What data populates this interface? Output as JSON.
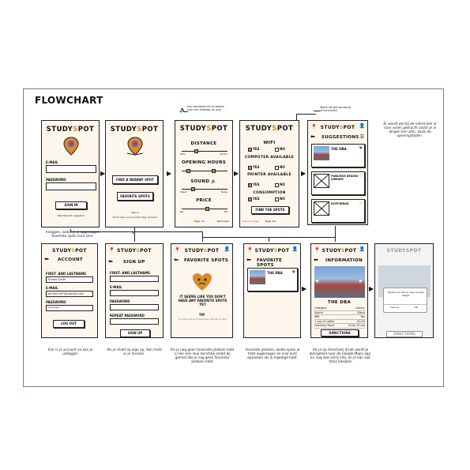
{
  "title": "FLOWCHART",
  "brand": {
    "name_start": "STUDY",
    "name_o": "S",
    "name_end": "POT",
    "accent": "#d98c2b",
    "frame": "#6f7f98"
  },
  "login": {
    "email": "E-MAIL",
    "password": "PASSWORD",
    "sign_in": "SIGN IN",
    "forgot": "Wachtwoord vergeten?",
    "caption": "Inloggen, zodat je je opgeslagen favoriete spots kunt zien."
  },
  "home": {
    "find": "FIND A NEARBY SPOT",
    "favorite": "FAVORITE SPOTS",
    "sign_in": "Sign in",
    "no_account": "Don't have an account? Sign up here!"
  },
  "filters1": {
    "distance": "DISTANCE",
    "d_min": "0km",
    "d_max": "20 km",
    "opening": "OPENING HOURS",
    "sound": "SOUND",
    "s_min": "Silent",
    "s_max": "Noisy",
    "price": "PRICE",
    "p_min": "€0",
    "p_max": "€5",
    "page": "Page 1/2",
    "next": "Next page",
    "annotation": "een voorbeeld om te zoeken naar een stiekkop de prijs"
  },
  "filters2": {
    "wifi": "WIFI",
    "yes": "YES",
    "no": "NO",
    "computer": "COMPUTER AVAILABLE",
    "printer": "PRINTER AVAILABLE",
    "consumption": "CONSUMPTION",
    "find": "FIND THE SPOTS",
    "prev": "Previous page",
    "page": "Page 2/2",
    "annotation": "Wordt als stijl aanwezig af verschillen"
  },
  "suggestions": {
    "header": "SUGGESTIONS",
    "s1": "THE DBA",
    "s2": "PUBLIEKE DESIGN LIBRARY",
    "s3": "KOFFIEBAR",
    "note": "Er wordt wel bij de informatie al naar voren gebracht zodat je al dingen kan zien, zoals de openingstijden."
  },
  "account": {
    "header": "ACCOUNT",
    "name_label": "FIRST- AND LASTNAME",
    "name": "Emma Smith",
    "email_label": "E-MAIL",
    "email": "emma1997@hotmail.com",
    "password_label": "PASSWORD",
    "password": "••••••",
    "logout": "LOG OUT",
    "caption": "hier is je account en kan je uitloggen"
  },
  "signup": {
    "header": "SIGN UP",
    "name": "FIRST- AND LASTNAME",
    "email": "E-MAIL",
    "password": "PASSWORD",
    "repeat": "REPEAT PASSWORD",
    "button": "SIGN UP",
    "caption": "Als je drukt op sign up, dan meld je je hieraan."
  },
  "empty_fav": {
    "header": "FAVORITE SPOTS",
    "msg": "IT SEEMS LIKE YOU DON'T HAVE ANY FAVORITE SPOTS YET",
    "tip": "TIP",
    "tip_text": "To add a spot to favorites just tap on the ♡",
    "caption": "Als je nog geen favoriete plekken hebt is hier een leuk berichtje zodat bij gemist dat je nog geen favoriete plekken hebt"
  },
  "fav": {
    "header": "FAVORITE SPOTS",
    "spot": "THE DBA",
    "caption": "favoriete plekken, welke spots je hebt opgeslagen en snel kunt opzoeken als je ingelogd hebt."
  },
  "info": {
    "header": "INFORMATION",
    "name": "THE DBA",
    "rows": [
      [
        "Category",
        "Library"
      ],
      [
        "Sound",
        "Silent"
      ],
      [
        "Wifi",
        "Yes"
      ],
      [
        "1 cup of coffee",
        "€2,50"
      ],
      [
        "Opening Hours",
        "8 am-10 pm"
      ]
    ],
    "directions": "DIRECTIONS",
    "caption": "Als je op directions drukt wordt je doorgeleid naar de Google Maps app. En nog wat extra info, en je kan ook fotos bekijken"
  },
  "dialog": {
    "text": "Would you like to open Google Maps?",
    "cancel": "Cancel",
    "ok": "OK",
    "directions": "DIRECTIONS"
  }
}
